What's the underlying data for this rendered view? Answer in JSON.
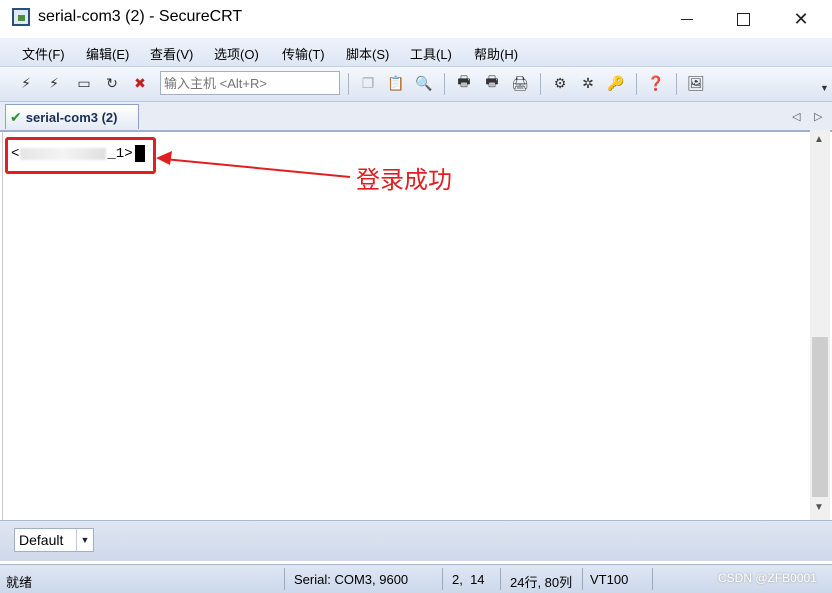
{
  "window": {
    "title": "serial-com3 (2) - SecureCRT"
  },
  "menu": [
    "文件(F)",
    "编辑(E)",
    "查看(V)",
    "选项(O)",
    "传输(T)",
    "脚本(S)",
    "工具(L)",
    "帮助(H)"
  ],
  "toolbar": {
    "host_placeholder": "输入主机 <Alt+R>"
  },
  "tab": {
    "label": "serial-com3 (2)"
  },
  "terminal": {
    "prompt_start": "<",
    "prompt_end": "_1>"
  },
  "annotation": {
    "text": "登录成功",
    "color": "#e02020"
  },
  "session_select": {
    "value": "Default"
  },
  "status": {
    "ready": "就绪",
    "connection": "Serial: COM3, 9600",
    "cursor_pos": "2,  14",
    "size": "24行, 80列",
    "emulation": "VT100"
  },
  "watermark": "CSDN @ZFB0001"
}
